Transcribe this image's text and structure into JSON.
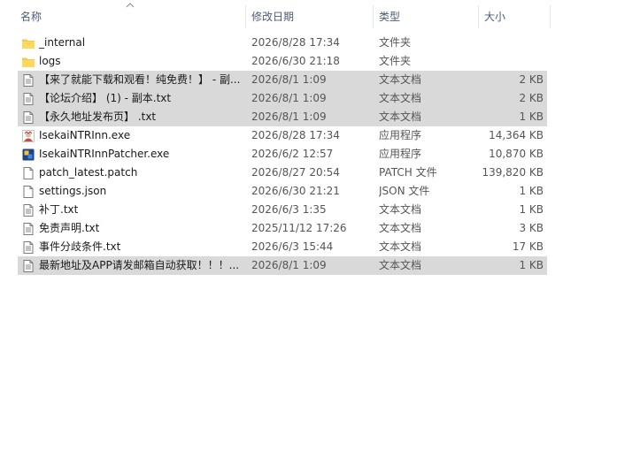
{
  "columns": {
    "name": "名称",
    "date": "修改日期",
    "type": "类型",
    "size": "大小"
  },
  "files": [
    {
      "name": "_internal",
      "date": "2026/8/28 17:34",
      "type": "文件夹",
      "size": "",
      "icon": "folder-icon",
      "selected": false
    },
    {
      "name": "logs",
      "date": "2026/6/30 21:18",
      "type": "文件夹",
      "size": "",
      "icon": "folder-icon",
      "selected": false
    },
    {
      "name": "【来了就能下载和观看！纯免费！】 - 副...",
      "date": "2026/8/1 1:09",
      "type": "文本文档",
      "size": "2 KB",
      "icon": "text-document-icon",
      "selected": true
    },
    {
      "name": "【论坛介绍】 (1) - 副本.txt",
      "date": "2026/8/1 1:09",
      "type": "文本文档",
      "size": "2 KB",
      "icon": "text-document-icon",
      "selected": true
    },
    {
      "name": "【永久地址发布页】 .txt",
      "date": "2026/8/1 1:09",
      "type": "文本文档",
      "size": "1 KB",
      "icon": "text-document-icon",
      "selected": true
    },
    {
      "name": "IsekaiNTRInn.exe",
      "date": "2026/8/28 17:34",
      "type": "应用程序",
      "size": "14,364 KB",
      "icon": "app-exe-icon",
      "selected": false
    },
    {
      "name": "IsekaiNTRInnPatcher.exe",
      "date": "2026/6/2 12:57",
      "type": "应用程序",
      "size": "10,870 KB",
      "icon": "patcher-exe-icon",
      "selected": false
    },
    {
      "name": "patch_latest.patch",
      "date": "2026/8/27 20:54",
      "type": "PATCH 文件",
      "size": "139,820 KB",
      "icon": "blank-file-icon",
      "selected": false
    },
    {
      "name": "settings.json",
      "date": "2026/6/30 21:21",
      "type": "JSON 文件",
      "size": "1 KB",
      "icon": "blank-file-icon",
      "selected": false
    },
    {
      "name": "补丁.txt",
      "date": "2026/6/3 1:35",
      "type": "文本文档",
      "size": "1 KB",
      "icon": "text-document-icon",
      "selected": false
    },
    {
      "name": "免责声明.txt",
      "date": "2025/11/12 17:26",
      "type": "文本文档",
      "size": "3 KB",
      "icon": "text-document-icon",
      "selected": false
    },
    {
      "name": "事件分歧条件.txt",
      "date": "2026/6/3 15:44",
      "type": "文本文档",
      "size": "17 KB",
      "icon": "text-document-icon",
      "selected": false
    },
    {
      "name": "最新地址及APP请发邮箱自动获取！！！...",
      "date": "2026/8/1 1:09",
      "type": "文本文档",
      "size": "1 KB",
      "icon": "text-document-icon",
      "selected": true
    }
  ],
  "colors": {
    "selected_row": "#d9d9d9",
    "header_text": "#4d5b73",
    "folder": "#f7c948"
  }
}
